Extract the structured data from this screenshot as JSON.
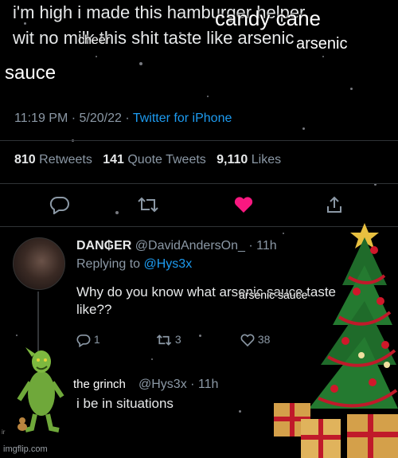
{
  "tweet": {
    "text_line1": "i'm high i made this hamburger helper",
    "text_line2": "wit no milk this shit taste like arsenic",
    "time": "11:19 PM",
    "date": "5/20/22",
    "separator": "·",
    "source": "Twitter for iPhone",
    "retweets_count": "810",
    "retweets_label": "Retweets",
    "quote_count": "141",
    "quote_label": "Quote Tweets",
    "likes_count": "9,110",
    "likes_label": "Likes"
  },
  "captions": {
    "candy_cane": "candy cane",
    "cheer": "cheer",
    "arsenic": "arsenic",
    "sauce": "sauce",
    "arsenic_sauce": "arsenic sauce",
    "the_grinch": "the grinch"
  },
  "reply": {
    "display_name": "DAN₲ER",
    "handle": "@DavidAndersOn_",
    "time": "11h",
    "replying_label": "Replying to",
    "replying_handle": "@Hys3x",
    "body_line1": "Why do you know what arsenic sauce taste",
    "body_line2": "like??",
    "reply_count": "1",
    "retweet_count": "3",
    "like_count": "38"
  },
  "reply2": {
    "handle": "@Hys3x",
    "time": "11h",
    "body": "i be in situations"
  },
  "footer": {
    "watermark": "imgflip.com",
    "small_mark": "ir"
  },
  "colors": {
    "background": "#000000",
    "link_blue": "#1d9bf0",
    "like_pink": "#f91880",
    "muted": "#8b98a5",
    "tree_green": "#1f6b2a",
    "ornament_red": "#d0182a",
    "gift_gold": "#d4a04a"
  }
}
